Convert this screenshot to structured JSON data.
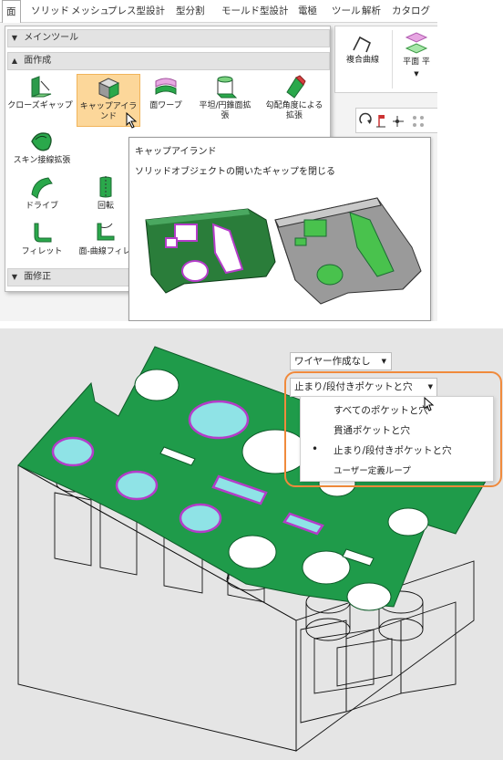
{
  "menu_tabs": [
    "面",
    "ソリッド",
    "メッシュ",
    "プレス型設計",
    "型分割",
    "モールド型設計",
    "電極",
    "ツール",
    "解析",
    "カタログ"
  ],
  "sections": {
    "main_tool": "メインツール",
    "surface_create": "面作成",
    "surface_modify": "面修正"
  },
  "commands": {
    "close_gap": "クローズギャップ",
    "cap_island": "キャップアイランド",
    "surface_warp": "面ワープ",
    "flat_cone_ext_1": "平坦/円錐面拡",
    "flat_cone_ext_2": "張",
    "draft_ext_1": "勾配角度による",
    "draft_ext_2": "拡張",
    "skin_tangent": "スキン接線拡張",
    "drive": "ドライブ",
    "revolve": "回転",
    "fillet": "フィレット",
    "surface_curve_fillet": "面-曲線フィレ"
  },
  "ribbon_right": {
    "composite_curve": "複合曲線",
    "plane": "平面 平"
  },
  "tooltip": {
    "title": "キャップアイランド",
    "description": "ソリッドオブジェクトの開いたギャップを閉じる"
  },
  "viewport": {
    "wire_combo": "ワイヤー作成なし",
    "mode_combo": "止まり/段付きポケットと穴",
    "options": [
      {
        "label": "すべてのポケットと穴",
        "selected": false
      },
      {
        "label": "貫通ポケットと穴",
        "selected": false
      },
      {
        "label": "止まり/段付きポケットと穴",
        "selected": true
      },
      {
        "label": "ユーザー定義ループ",
        "selected": false
      }
    ],
    "bullet": "•"
  },
  "colors": {
    "accent_green": "#1f9b4a",
    "cap_cyan": "#8fe3e6",
    "cap_outline": "#b43cc9",
    "highlight_orange": "#f08a3c",
    "selected_command_bg": "#fcd79a"
  }
}
